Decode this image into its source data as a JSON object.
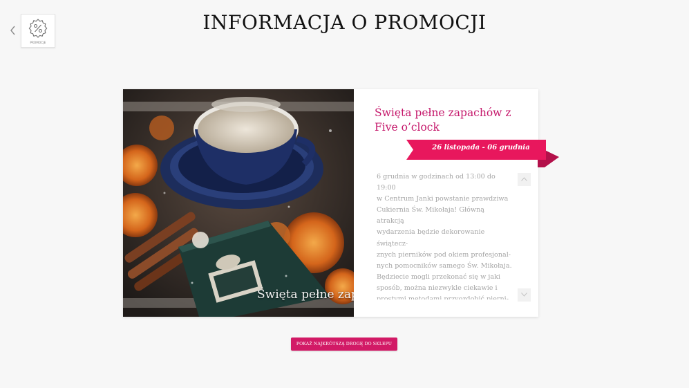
{
  "header": {
    "title": "INFORMACJA O PROMOCJI",
    "back_icon": "chevron-left-icon",
    "category": {
      "icon": "discount-badge-icon",
      "label": "PROMOCJE"
    }
  },
  "promotion": {
    "title": "Święta pełne zapachów z Five o’clock",
    "date_range": "26 listopada - 06 grudnia",
    "image_caption": "Święta pełne zap",
    "description": "6 grudnia w godzinach od 13:00 do 19:00\nw Centrum Janki powstanie prawdziwa\nCukiernia Św. Mikołaja! Główną atrakcją\nwydarzenia będzie dekorowanie świątecz-\nznych pierników pod okiem profesjonal-\nnych pomocników samego Św. Mikołaja.\nBędziecie mogli przekonać się w jaki\nsposób, można niezwykle ciekawie i\nprostymi metodami przyozdobić pierni-\nki. Dla dzieci, które w danym momencie\nnie będą uczestniczyć w warsztatach zdo-\nbienia pierników, przygotowane zostaną",
    "scroll_up_icon": "chevron-up-icon",
    "scroll_down_icon": "chevron-down-icon"
  },
  "actions": {
    "route_button": "POKAŻ NAJKRÓTSZĄ DROGĘ DO SKLEPU"
  },
  "colors": {
    "accent": "#d21a66",
    "title_pink": "#c5186b",
    "ribbon": "#e8175d",
    "ribbon_fold": "#b3104a",
    "background": "#f7f7f7"
  }
}
